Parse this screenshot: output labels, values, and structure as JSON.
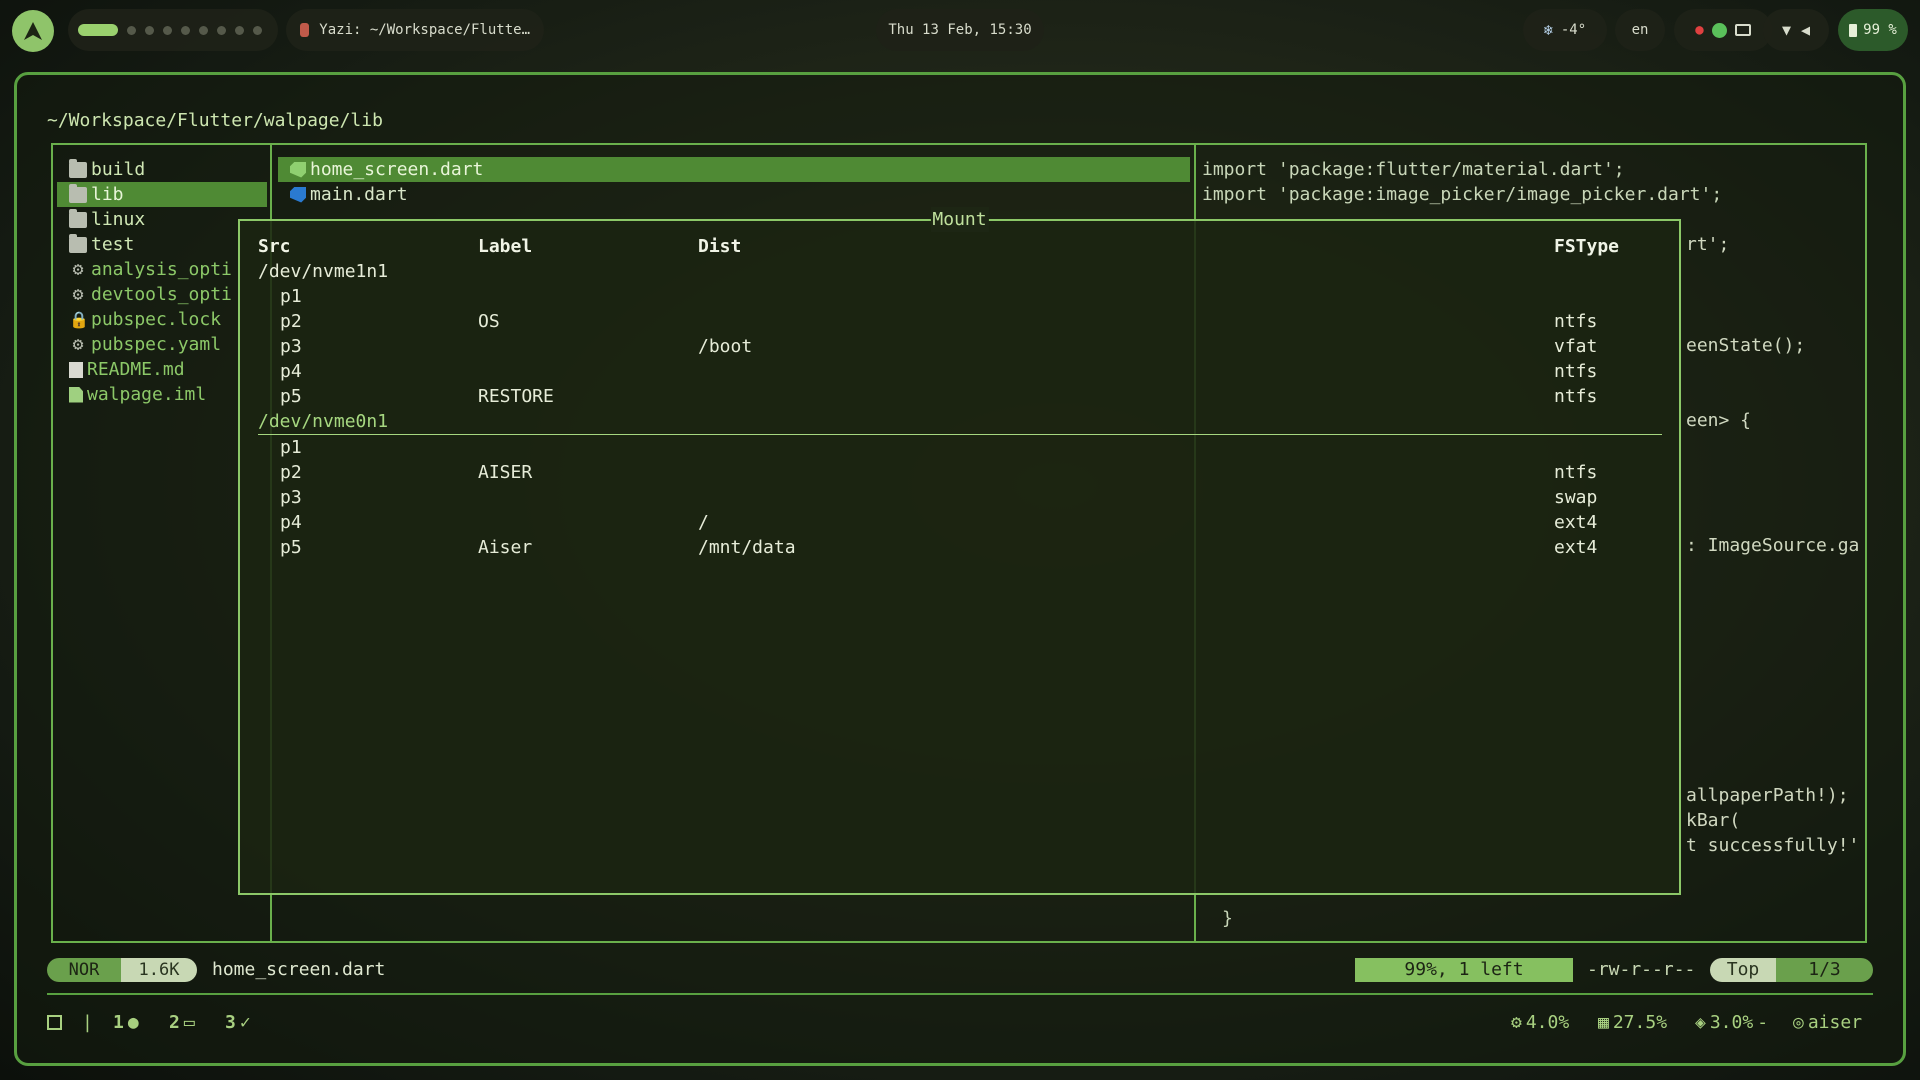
{
  "topbar": {
    "window_title": "Yazi: ~/Workspace/Flutte…",
    "clock": "Thu 13 Feb, 15:30",
    "weather_icon": "snowflake-icon",
    "temperature": "-4°",
    "keyboard_layout": "en",
    "battery": "99 %"
  },
  "yazi": {
    "cwd": "~/Workspace/Flutter/walpage/lib",
    "parent_entries": [
      {
        "name": "build",
        "type": "dir"
      },
      {
        "name": "lib",
        "type": "dir",
        "selected": true
      },
      {
        "name": "linux",
        "type": "dir"
      },
      {
        "name": "test",
        "type": "dir"
      },
      {
        "name": "analysis_opti",
        "type": "config"
      },
      {
        "name": "devtools_opti",
        "type": "config"
      },
      {
        "name": "pubspec.lock",
        "type": "lock"
      },
      {
        "name": "pubspec.yaml",
        "type": "config"
      },
      {
        "name": "README.md",
        "type": "markdown"
      },
      {
        "name": "walpage.iml",
        "type": "file"
      }
    ],
    "current_entries": [
      {
        "name": "home_screen.dart",
        "selected": true
      },
      {
        "name": "main.dart"
      }
    ],
    "preview_top": [
      "import 'package:flutter/material.dart';",
      "import 'package:image_picker/image_picker.dart';"
    ],
    "preview_right": [
      "rt';",
      "eenState();",
      "een> {",
      ": ImageSource.ga",
      "allpaperPath!);",
      "kBar(",
      "t successfully!'"
    ],
    "preview_bottom": "}",
    "mount": {
      "title": "Mount",
      "headers": {
        "src": "Src",
        "label": "Label",
        "dist": "Dist",
        "fstype": "FSType"
      },
      "disks": [
        {
          "device": "/dev/nvme1n1",
          "parts": [
            {
              "src": "p1",
              "label": "",
              "dist": "",
              "fstype": ""
            },
            {
              "src": "p2",
              "label": "OS",
              "dist": "",
              "fstype": "ntfs"
            },
            {
              "src": "p3",
              "label": "",
              "dist": "/boot",
              "fstype": "vfat"
            },
            {
              "src": "p4",
              "label": "",
              "dist": "",
              "fstype": "ntfs"
            },
            {
              "src": "p5",
              "label": "RESTORE",
              "dist": "",
              "fstype": "ntfs"
            }
          ]
        },
        {
          "device": "/dev/nvme0n1",
          "selected": true,
          "parts": [
            {
              "src": "p1",
              "label": "",
              "dist": "",
              "fstype": ""
            },
            {
              "src": "p2",
              "label": "AISER",
              "dist": "",
              "fstype": "ntfs"
            },
            {
              "src": "p3",
              "label": "",
              "dist": "",
              "fstype": "swap"
            },
            {
              "src": "p4",
              "label": "",
              "dist": "/",
              "fstype": "ext4"
            },
            {
              "src": "p5",
              "label": "Aiser",
              "dist": "/mnt/data",
              "fstype": "ext4"
            }
          ]
        }
      ]
    },
    "status": {
      "mode": "NOR",
      "size": "1.6K",
      "filename": "home_screen.dart",
      "progress": "99%, 1 left",
      "permissions": "-rw-r--r--",
      "position": "Top",
      "page": "1/3"
    }
  },
  "bottombar": {
    "workspaces": [
      "1",
      "2",
      "3"
    ],
    "cpu": "4.0%",
    "memory": "27.5%",
    "disk": "3.0%",
    "user": "aiser"
  },
  "colors": {
    "accent": "#6ab04c",
    "selection": "#4f8a34",
    "text": "#e6ecd8"
  }
}
